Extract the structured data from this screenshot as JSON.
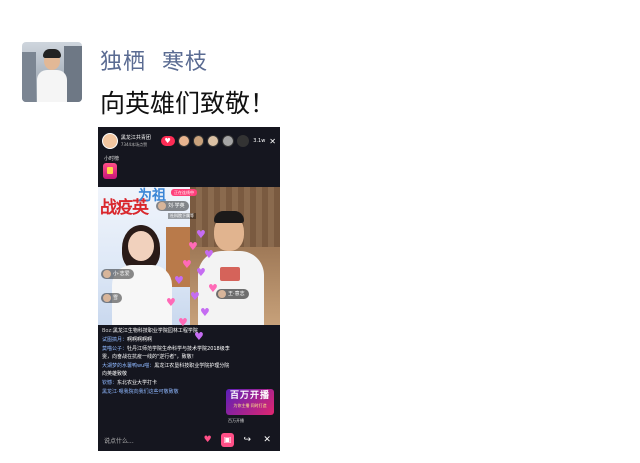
{
  "post": {
    "author": "独栖  寒枝",
    "text": "向英雄们致敬！"
  },
  "live": {
    "host_name": "黑龙江共青团",
    "host_sub": "7344本场点赞",
    "viewer_count": "3.1w",
    "subtitle": "小时榜",
    "banner_text": "战疫英",
    "banner_top": "为祖",
    "pink_tag": "正在连线中",
    "tag_top": "刘·学英",
    "tag_top_sub": "社科院下属等",
    "tag_mid": "小·志爱",
    "tag_low": "雪",
    "tag_right": "王·意志",
    "comments": [
      {
        "user": "Boz:",
        "text": "黑龙江生物科技职业学院园林工程学院",
        "user_style": "w"
      },
      {
        "user": "试图搞月：",
        "text": "啊啊啊啊啊"
      },
      {
        "user": "莫喵公子：",
        "text": "牡丹江师范学院生命科学与技术学院2018级李雯，向奋战在抗疫一线的\"逆行者\"，致敬！"
      },
      {
        "user": "大湖梦的水薯鸭wu喵：",
        "text": "黑龙江农垦科技职业学院护理分院向英雄致敬"
      },
      {
        "user": "钦憾：",
        "text": "东北农业大学打卡"
      },
      {
        "user": "",
        "text": "黑龙江·嗯我院向我们这些可敬致敬"
      }
    ],
    "promo_title": "百万开播",
    "promo_sub": "为你主播 同时打造",
    "promo_caption": "百万开播",
    "input_placeholder": "说点什么...",
    "close_symbol": "✕",
    "follow_symbol": "♥"
  }
}
